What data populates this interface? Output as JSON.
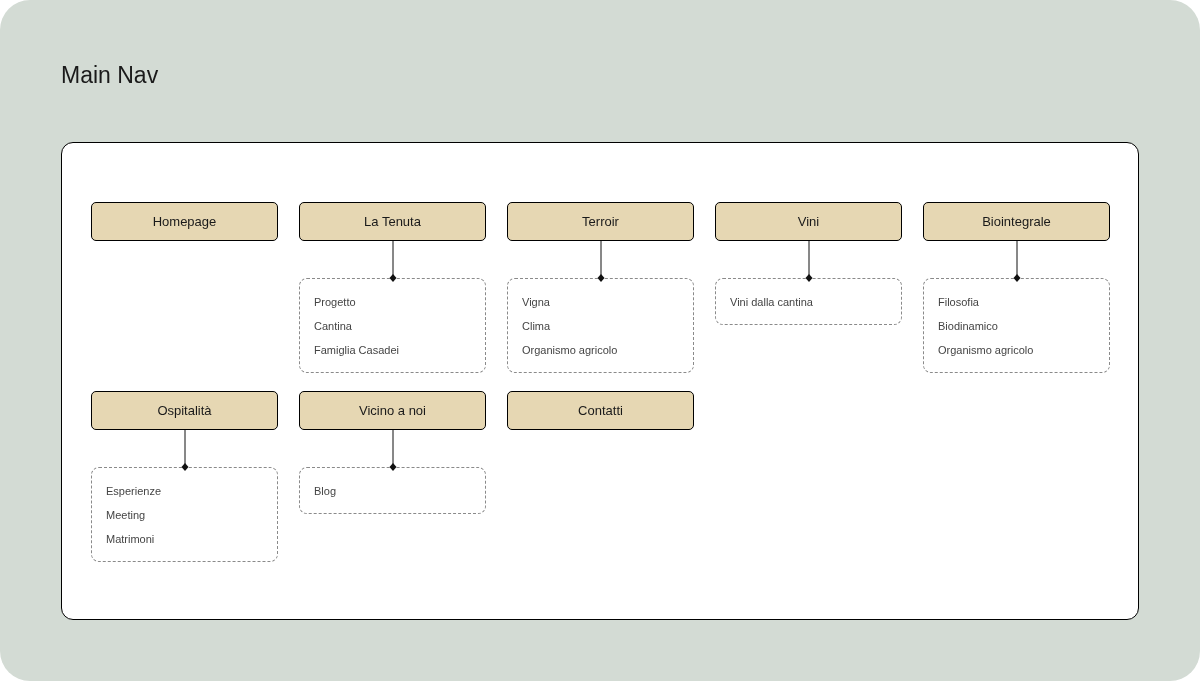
{
  "title": "Main Nav",
  "nav": [
    {
      "label": "Homepage"
    },
    {
      "label": "La Tenuta",
      "children": [
        {
          "label": "Progetto"
        },
        {
          "label": "Cantina"
        },
        {
          "label": "Famiglia Casadei"
        }
      ]
    },
    {
      "label": "Terroir",
      "children": [
        {
          "label": "Vigna"
        },
        {
          "label": "Clima"
        },
        {
          "label": "Organismo agricolo"
        }
      ]
    },
    {
      "label": "Vini",
      "children": [
        {
          "label": "Vini dalla cantina"
        }
      ]
    },
    {
      "label": "Biointegrale",
      "children": [
        {
          "label": "Filosofia"
        },
        {
          "label": "Biodinamico"
        },
        {
          "label": "Organismo agricolo"
        }
      ]
    },
    {
      "label": "Ospitalità",
      "children": [
        {
          "label": "Esperienze"
        },
        {
          "label": "Meeting"
        },
        {
          "label": "Matrimoni"
        }
      ]
    },
    {
      "label": "Vicino a noi",
      "children": [
        {
          "label": "Blog"
        }
      ]
    },
    {
      "label": "Contatti"
    }
  ]
}
